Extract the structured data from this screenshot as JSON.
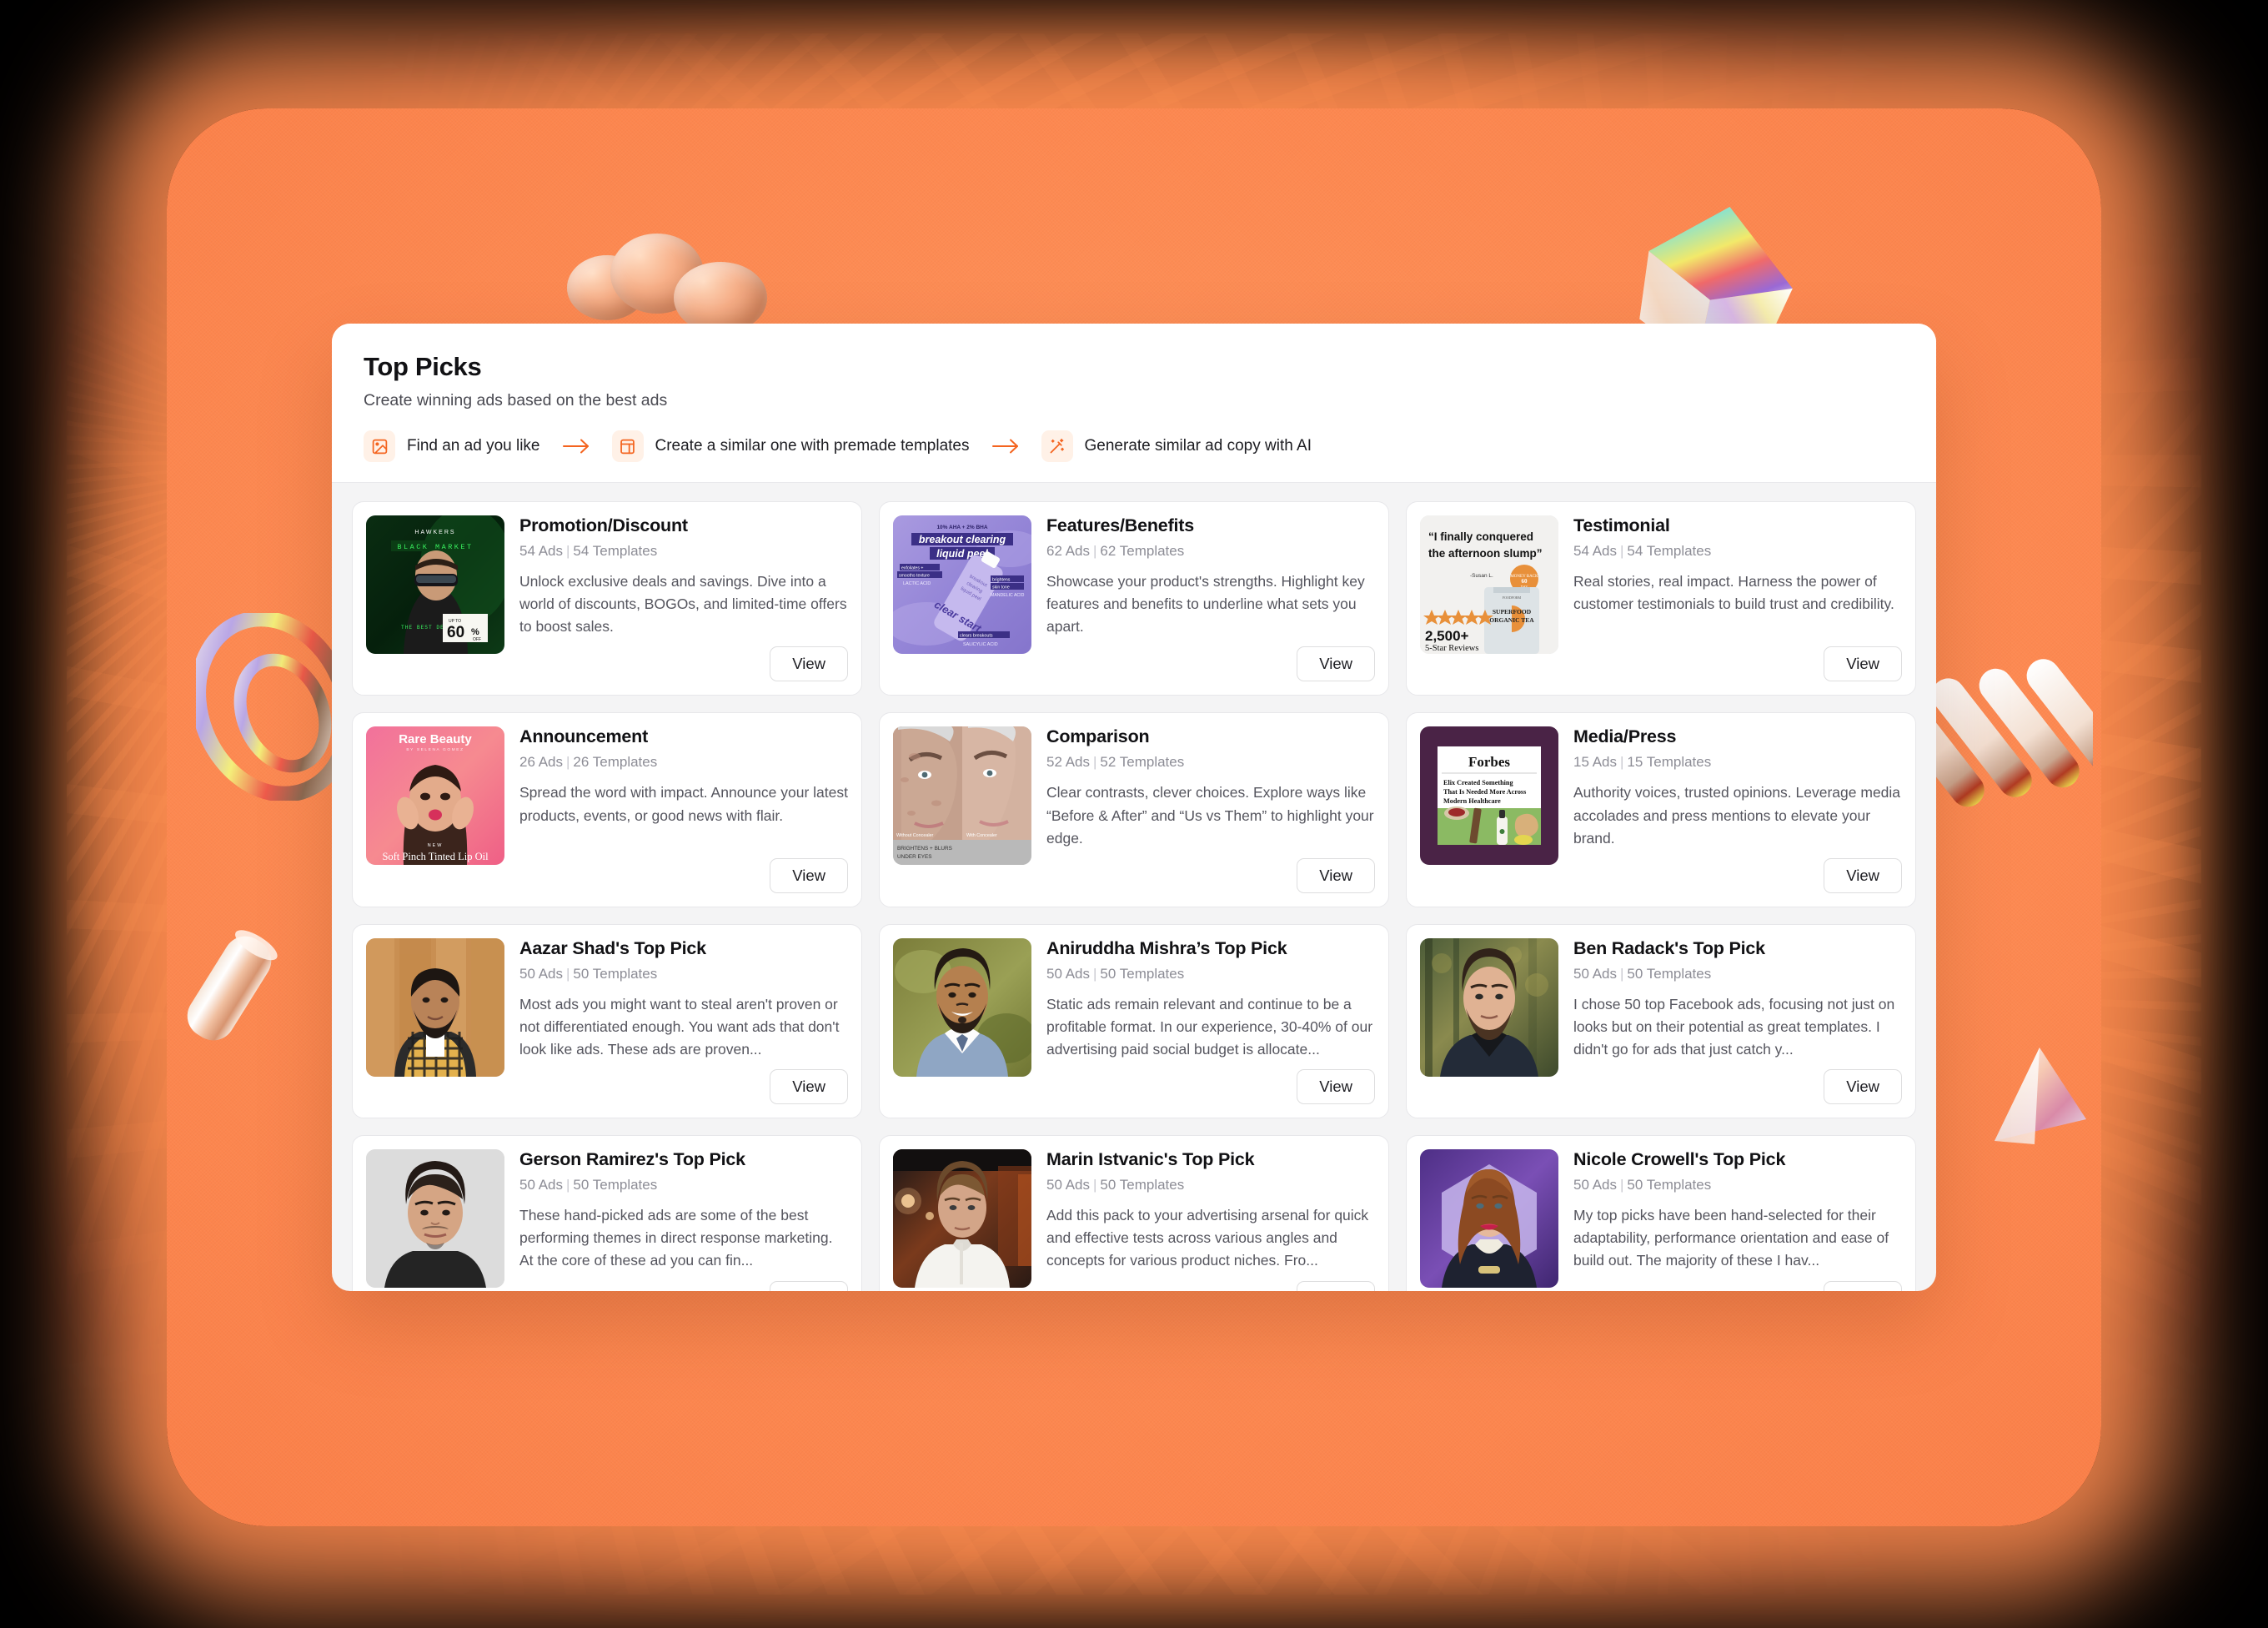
{
  "panel": {
    "title": "Top Picks",
    "subtitle": "Create winning ads based on the best ads",
    "steps": [
      {
        "icon": "image-icon",
        "label": "Find an ad you like"
      },
      {
        "icon": "template-icon",
        "label": "Create a similar one with premade templates"
      },
      {
        "icon": "magic-wand-icon",
        "label": "Generate similar ad copy with AI"
      }
    ],
    "arrow_icon": "arrow-right-icon"
  },
  "colors": {
    "accent": "#f4641f",
    "chip_bg": "#fff1e7",
    "panel_bg": "#f4f4f5",
    "card_bg": "#ffffff",
    "background_orange": "#fd8a52"
  },
  "view_label": "View",
  "cards": [
    {
      "title": "Promotion/Discount",
      "ads": "54 Ads",
      "templates": "54 Templates",
      "description": "Unlock exclusive deals and savings. Dive into a world of discounts, BOGOs, and limited-time offers to boost sales.",
      "thumb": "hawkers-black-market-sunglasses-60-percent-off",
      "thumb_text": [
        "HAWKERS",
        "BLACK MARKET",
        "THE BEST DEALS",
        "UP TO",
        "60",
        "%",
        "OFF"
      ]
    },
    {
      "title": "Features/Benefits",
      "ads": "62 Ads",
      "templates": "62 Templates",
      "description": "Showcase your product's strengths. Highlight key features and benefits to underline what sets you apart.",
      "thumb": "clear-start-breakout-clearing-liquid-peel",
      "thumb_text": [
        "10% AHA + 2% BHA",
        "breakout clearing",
        "liquid peel",
        "exfoliates + smooths texture",
        "LACTIC ACID",
        "brightens skin tone",
        "MANDELIC ACID",
        "clears breakouts",
        "SALICYLIC ACID",
        "clear start"
      ]
    },
    {
      "title": "Testimonial",
      "ads": "54 Ads",
      "templates": "54 Templates",
      "description": "Real stories, real impact. Harness the power of customer testimonials to build trust and credibility.",
      "thumb": "superfood-organic-tea-testimonial",
      "thumb_text": [
        "“I finally conquered",
        "the afternoon slump”",
        "-Susan L.",
        "2,500+",
        "5-Star Reviews",
        "MONEY BACK GUARANTEE",
        "60 DAY",
        "SUPERFOOD",
        "ORGANIC TEA"
      ]
    },
    {
      "title": "Announcement",
      "ads": "26 Ads",
      "templates": "26 Templates",
      "description": "Spread the word with impact. Announce your latest products, events, or good news with flair.",
      "thumb": "rare-beauty-soft-pinch-tinted-lip-oil",
      "thumb_text": [
        "Rare Beauty",
        "BY SELENA GOMEZ",
        "NEW",
        "Soft Pinch Tinted Lip Oil"
      ]
    },
    {
      "title": "Comparison",
      "ads": "52 Ads",
      "templates": "52 Templates",
      "description": "Clear contrasts, clever choices. Explore ways like “Before & After” and “Us vs Them” to highlight your edge.",
      "thumb": "before-after-concealer-comparison",
      "thumb_text": [
        "Without Concealer",
        "With Concealer",
        "BRIGHTENS + BLURS",
        "UNDER EYES"
      ]
    },
    {
      "title": "Media/Press",
      "ads": "15 Ads",
      "templates": "15 Templates",
      "description": "Authority voices, trusted opinions. Leverage media accolades and press mentions to elevate your brand.",
      "thumb": "forbes-elix-press-feature",
      "thumb_text": [
        "Forbes",
        "Elix Created Something",
        "That Is Needed  More Across",
        "Modern Healthcare"
      ]
    },
    {
      "title": "Aazar Shad's Top Pick",
      "ads": "50 Ads",
      "templates": "50 Templates",
      "description": "Most ads you might want to steal aren't proven or not differentiated enough. You want ads that don't look like ads. These ads are proven...",
      "thumb": "aazar-shad-portrait",
      "thumb_text": []
    },
    {
      "title": "Aniruddha Mishra’s Top Pick",
      "ads": "50 Ads",
      "templates": "50 Templates",
      "description": "Static ads remain relevant and continue to be a profitable format. In our experience, 30-40% of our advertising paid social budget is allocate...",
      "thumb": "aniruddha-mishra-portrait",
      "thumb_text": []
    },
    {
      "title": "Ben Radack's Top Pick",
      "ads": "50 Ads",
      "templates": "50 Templates",
      "description": "I chose 50 top Facebook ads, focusing not just on looks but on their potential as great templates. I didn't go for ads that just catch y...",
      "thumb": "ben-radack-portrait",
      "thumb_text": []
    },
    {
      "title": "Gerson Ramirez's Top Pick",
      "ads": "50 Ads",
      "templates": "50 Templates",
      "description": "These hand-picked ads are some of the best performing themes in direct response marketing. At the core of these ad you can fin...",
      "thumb": "gerson-ramirez-portrait",
      "thumb_text": []
    },
    {
      "title": "Marin Istvanic's Top Pick",
      "ads": "50 Ads",
      "templates": "50 Templates",
      "description": "Add this pack to your advertising arsenal for quick and effective tests across various angles and concepts for various product niches. Fro...",
      "thumb": "marin-istvanic-portrait",
      "thumb_text": []
    },
    {
      "title": "Nicole Crowell's Top Pick",
      "ads": "50 Ads",
      "templates": "50 Templates",
      "description": "My top picks have been hand-selected for their adaptability, performance orientation and ease of build out. The majority of these I hav...",
      "thumb": "nicole-crowell-portrait",
      "thumb_text": []
    }
  ],
  "decorations": [
    {
      "name": "blob-cluster-3d"
    },
    {
      "name": "iridescent-diamond-3d"
    },
    {
      "name": "iridescent-ring-3d"
    },
    {
      "name": "glass-cylinder-3d"
    },
    {
      "name": "glass-nails-3d"
    },
    {
      "name": "glass-triangle-3d"
    }
  ]
}
